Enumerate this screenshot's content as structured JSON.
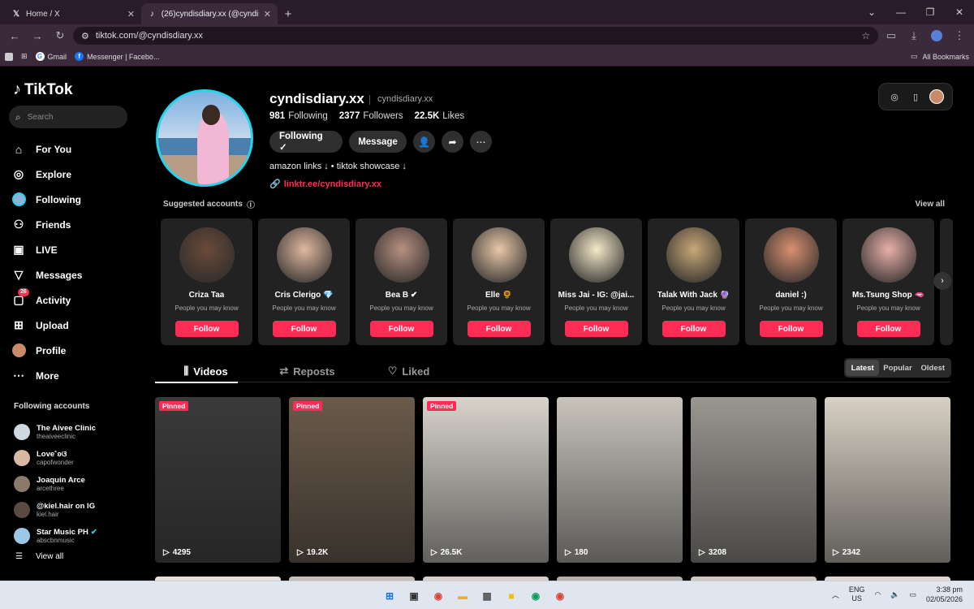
{
  "browser": {
    "tabs": [
      {
        "title": "Home / X",
        "icon": "x-logo-icon"
      },
      {
        "title": "(26)cyndisdiary.xx (@cyndisdiar",
        "icon": "tiktok-icon"
      }
    ],
    "url": "tiktok.com/@cyndisdiary.xx",
    "bookmarks": [
      {
        "label": "Gmail"
      },
      {
        "label": "Messenger | Facebo..."
      }
    ],
    "all_bookmarks": "All Bookmarks"
  },
  "sidebar": {
    "logo": "TikTok",
    "search_placeholder": "Search",
    "nav": [
      {
        "label": "For You",
        "icon": "home-icon"
      },
      {
        "label": "Explore",
        "icon": "compass-icon"
      },
      {
        "label": "Following",
        "icon": "following-avatar-icon"
      },
      {
        "label": "Friends",
        "icon": "friends-icon"
      },
      {
        "label": "LIVE",
        "icon": "live-icon"
      },
      {
        "label": "Messages",
        "icon": "messages-icon"
      },
      {
        "label": "Activity",
        "icon": "activity-icon",
        "badge": "26"
      },
      {
        "label": "Upload",
        "icon": "upload-icon"
      },
      {
        "label": "Profile",
        "icon": "profile-avatar-icon"
      },
      {
        "label": "More",
        "icon": "more-dots-icon"
      }
    ],
    "following_title": "Following accounts",
    "following": [
      {
        "name": "The Aivee Clinic",
        "handle": "theaiveeclinic",
        "color": "#cfd8e0"
      },
      {
        "name": "Love˚ʚଓ",
        "handle": "capofwonder",
        "color": "#d8b8a0"
      },
      {
        "name": "Joaquin Arce",
        "handle": "arcethree",
        "color": "#8a7a6a"
      },
      {
        "name": "@kiel.hair on IG",
        "handle": "kiel.hair",
        "color": "#5a4a40"
      },
      {
        "name": "Star Music PH",
        "handle": "abscbnmusic",
        "color": "#9cc8e8",
        "verified": true
      }
    ],
    "view_all": "View all"
  },
  "profile": {
    "username": "cyndisdiary.xx",
    "handle": "cyndisdiary.xx",
    "following_count": "981",
    "following_label": "Following",
    "followers_count": "2377",
    "followers_label": "Followers",
    "likes_count": "22.5K",
    "likes_label": "Likes",
    "following_btn": "Following ✓",
    "message_btn": "Message",
    "bio": "amazon links ↓ • tiktok showcase ↓",
    "link": "linktr.ee/cyndisdiary.xx"
  },
  "suggested": {
    "title": "Suggested accounts",
    "view_all": "View all",
    "cards": [
      {
        "name": "Criza Taa",
        "sub": "People you may know",
        "follow": "Follow",
        "color": "#6a4a3a"
      },
      {
        "name": "Cris Clerigo 💎",
        "sub": "People you may know",
        "follow": "Follow",
        "color": "#e0b8a0"
      },
      {
        "name": "Bea B ✔",
        "sub": "People you may know",
        "follow": "Follow",
        "color": "#b89080"
      },
      {
        "name": "Elle 🌻",
        "sub": "People you may know",
        "follow": "Follow",
        "color": "#e8c8a8"
      },
      {
        "name": "Miss Jai - IG: @jai...",
        "sub": "People you may know",
        "follow": "Follow",
        "color": "#f4e8c8"
      },
      {
        "name": "Talak With Jack 🔮",
        "sub": "People you may know",
        "follow": "Follow",
        "color": "#c8a878"
      },
      {
        "name": "daniel :)",
        "sub": "People you may know",
        "follow": "Follow",
        "color": "#d89070"
      },
      {
        "name": "Ms.Tsung Shop 🫦",
        "sub": "People you may know",
        "follow": "Follow",
        "color": "#e8b0a8"
      }
    ]
  },
  "video_tabs": [
    {
      "label": "Videos",
      "icon": "grid-icon"
    },
    {
      "label": "Reposts",
      "icon": "repost-icon"
    },
    {
      "label": "Liked",
      "icon": "heart-outline-icon"
    }
  ],
  "sort": {
    "options": [
      "Latest",
      "Popular",
      "Oldest"
    ],
    "selected": "Latest"
  },
  "videos": [
    {
      "pinned": "Pinned",
      "views": "4295",
      "bg": "#3a3a3a"
    },
    {
      "pinned": "Pinned",
      "views": "19.2K",
      "bg": "#6a5a4a"
    },
    {
      "pinned": "Pinned",
      "views": "26.5K",
      "bg": "#d8d4cc"
    },
    {
      "views": "180",
      "bg": "#c8c4bc"
    },
    {
      "views": "3208",
      "bg": "#9a9690"
    },
    {
      "views": "2342",
      "bg": "#d8d0c4"
    }
  ],
  "taskbar": {
    "lang": "ENG",
    "region": "US",
    "time": "3:38 pm",
    "date": "02/05/2026"
  }
}
